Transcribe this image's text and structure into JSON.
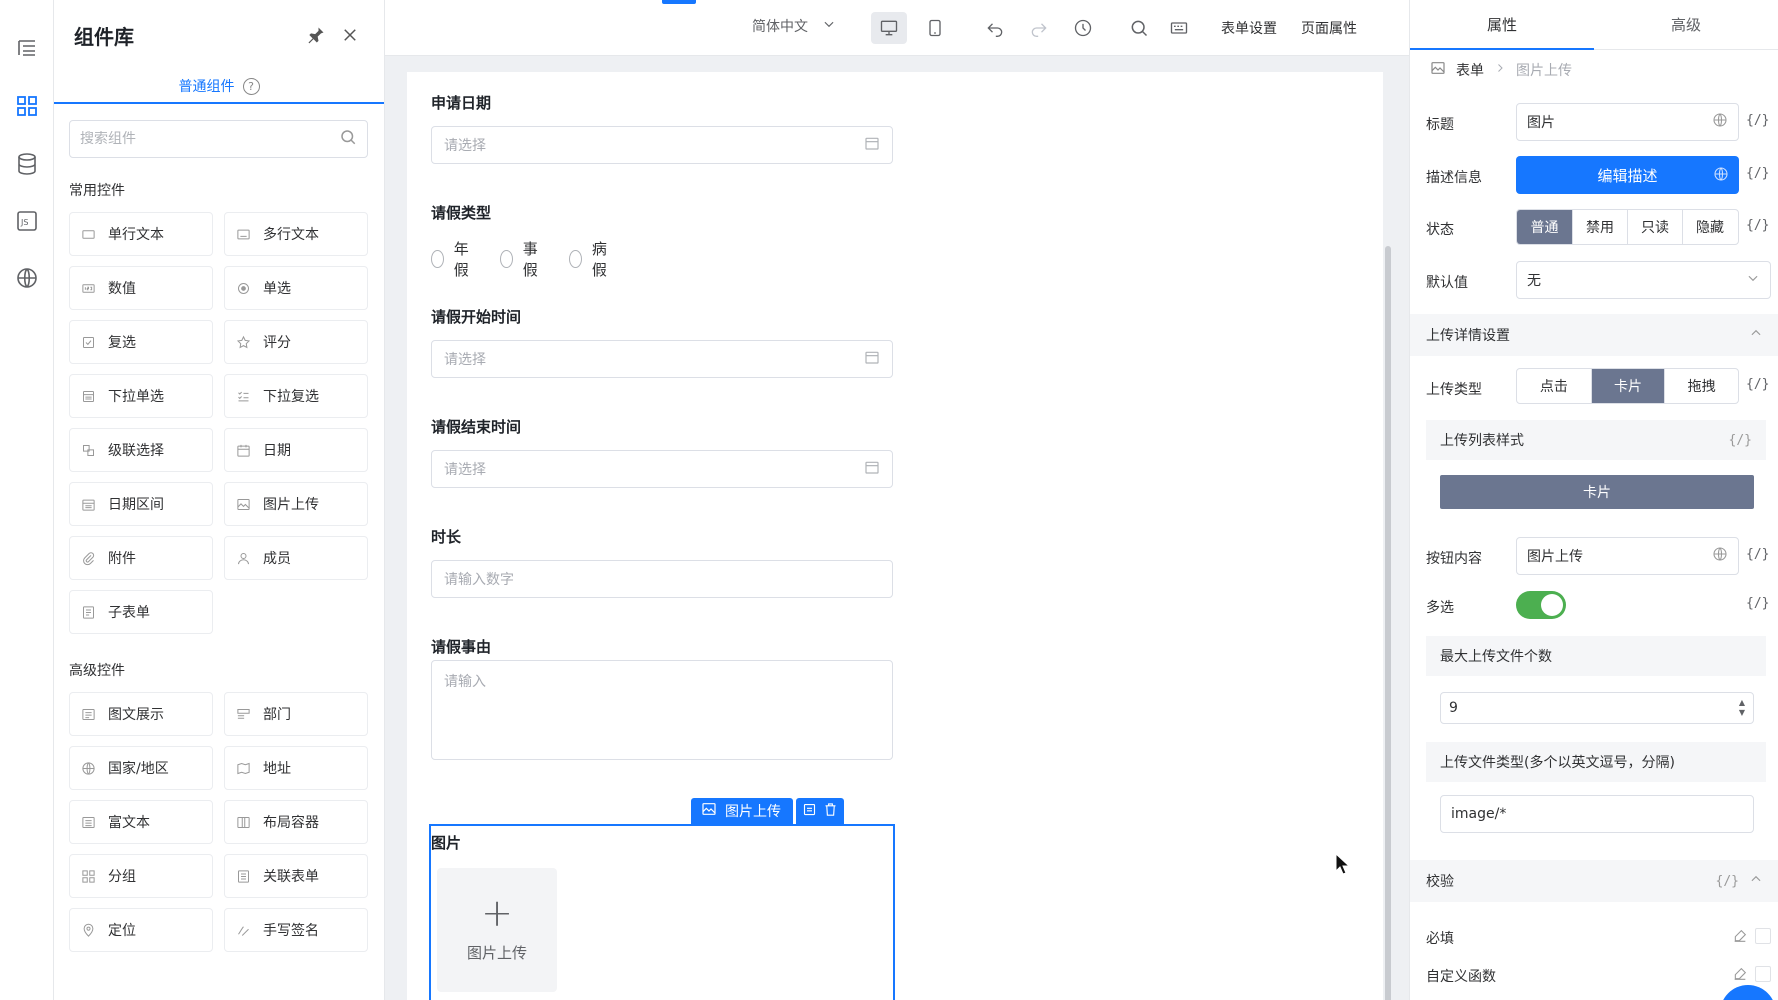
{
  "library": {
    "title": "组件库",
    "tab": "普通组件",
    "search_placeholder": "搜索组件",
    "common_title": "常用控件",
    "common_items": [
      {
        "label": "单行文本",
        "icon": "textbox-icon"
      },
      {
        "label": "多行文本",
        "icon": "textarea-icon"
      },
      {
        "label": "数值",
        "icon": "number-icon"
      },
      {
        "label": "单选",
        "icon": "radio-icon"
      },
      {
        "label": "复选",
        "icon": "checkbox-icon"
      },
      {
        "label": "评分",
        "icon": "star-icon"
      },
      {
        "label": "下拉单选",
        "icon": "dropdown-icon"
      },
      {
        "label": "下拉复选",
        "icon": "list-check-icon"
      },
      {
        "label": "级联选择",
        "icon": "cascade-icon"
      },
      {
        "label": "日期",
        "icon": "calendar-icon"
      },
      {
        "label": "日期区间",
        "icon": "calendar-range-icon"
      },
      {
        "label": "图片上传",
        "icon": "image-icon"
      },
      {
        "label": "附件",
        "icon": "paperclip-icon"
      },
      {
        "label": "成员",
        "icon": "user-icon"
      },
      {
        "label": "子表单",
        "icon": "subform-icon"
      }
    ],
    "advanced_title": "高级控件",
    "advanced_items": [
      {
        "label": "图文展示",
        "icon": "richtext-display-icon"
      },
      {
        "label": "部门",
        "icon": "department-icon"
      },
      {
        "label": "国家/地区",
        "icon": "globe-icon"
      },
      {
        "label": "地址",
        "icon": "map-icon"
      },
      {
        "label": "富文本",
        "icon": "richtext-icon"
      },
      {
        "label": "布局容器",
        "icon": "layout-icon"
      },
      {
        "label": "分组",
        "icon": "group-icon"
      },
      {
        "label": "关联表单",
        "icon": "linked-form-icon"
      },
      {
        "label": "定位",
        "icon": "location-pin-icon"
      },
      {
        "label": "手写签名",
        "icon": "signature-icon"
      }
    ]
  },
  "toolbar": {
    "language": "简体中文",
    "form_settings": "表单设置",
    "page_props": "页面属性"
  },
  "form": {
    "date_label": "申请日期",
    "date_placeholder": "请选择",
    "type_label": "请假类型",
    "type_options": [
      "年假",
      "事假",
      "病假"
    ],
    "start_label": "请假开始时间",
    "start_placeholder": "请选择",
    "end_label": "请假结束时间",
    "end_placeholder": "请选择",
    "duration_label": "时长",
    "duration_placeholder": "请输入数字",
    "reason_label": "请假事由",
    "reason_placeholder": "请输入",
    "selected_tag": "图片上传",
    "image_label": "图片",
    "upload_text": "图片上传",
    "upload_plus": "+"
  },
  "props": {
    "tab_props": "属性",
    "tab_advanced": "高级",
    "crumb_root": "表单",
    "crumb_leaf": "图片上传",
    "title_label": "标题",
    "title_value": "图片",
    "desc_label": "描述信息",
    "desc_button": "编辑描述",
    "state_label": "状态",
    "state_options": [
      "普通",
      "禁用",
      "只读",
      "隐藏"
    ],
    "state_selected": "普通",
    "default_label": "默认值",
    "default_value": "无",
    "upload_section": "上传详情设置",
    "upload_type_label": "上传类型",
    "upload_types": [
      "点击",
      "卡片",
      "拖拽"
    ],
    "upload_type_selected": "卡片",
    "list_style_label": "上传列表样式",
    "list_style_value": "卡片",
    "button_label": "按钮内容",
    "button_value": "图片上传",
    "multi_label": "多选",
    "multi_on": true,
    "max_files_label": "最大上传文件个数",
    "max_files_value": "9",
    "file_types_label": "上传文件类型(多个以英文逗号，分隔)",
    "file_types_value": "image/*",
    "validate_section": "校验",
    "required_label": "必填",
    "custom_fn_label": "自定义函数",
    "fx": "{/}"
  },
  "colors": {
    "accent": "#1677ff",
    "selected_segment": "#6b7690",
    "toggle_on": "#4caf50"
  }
}
